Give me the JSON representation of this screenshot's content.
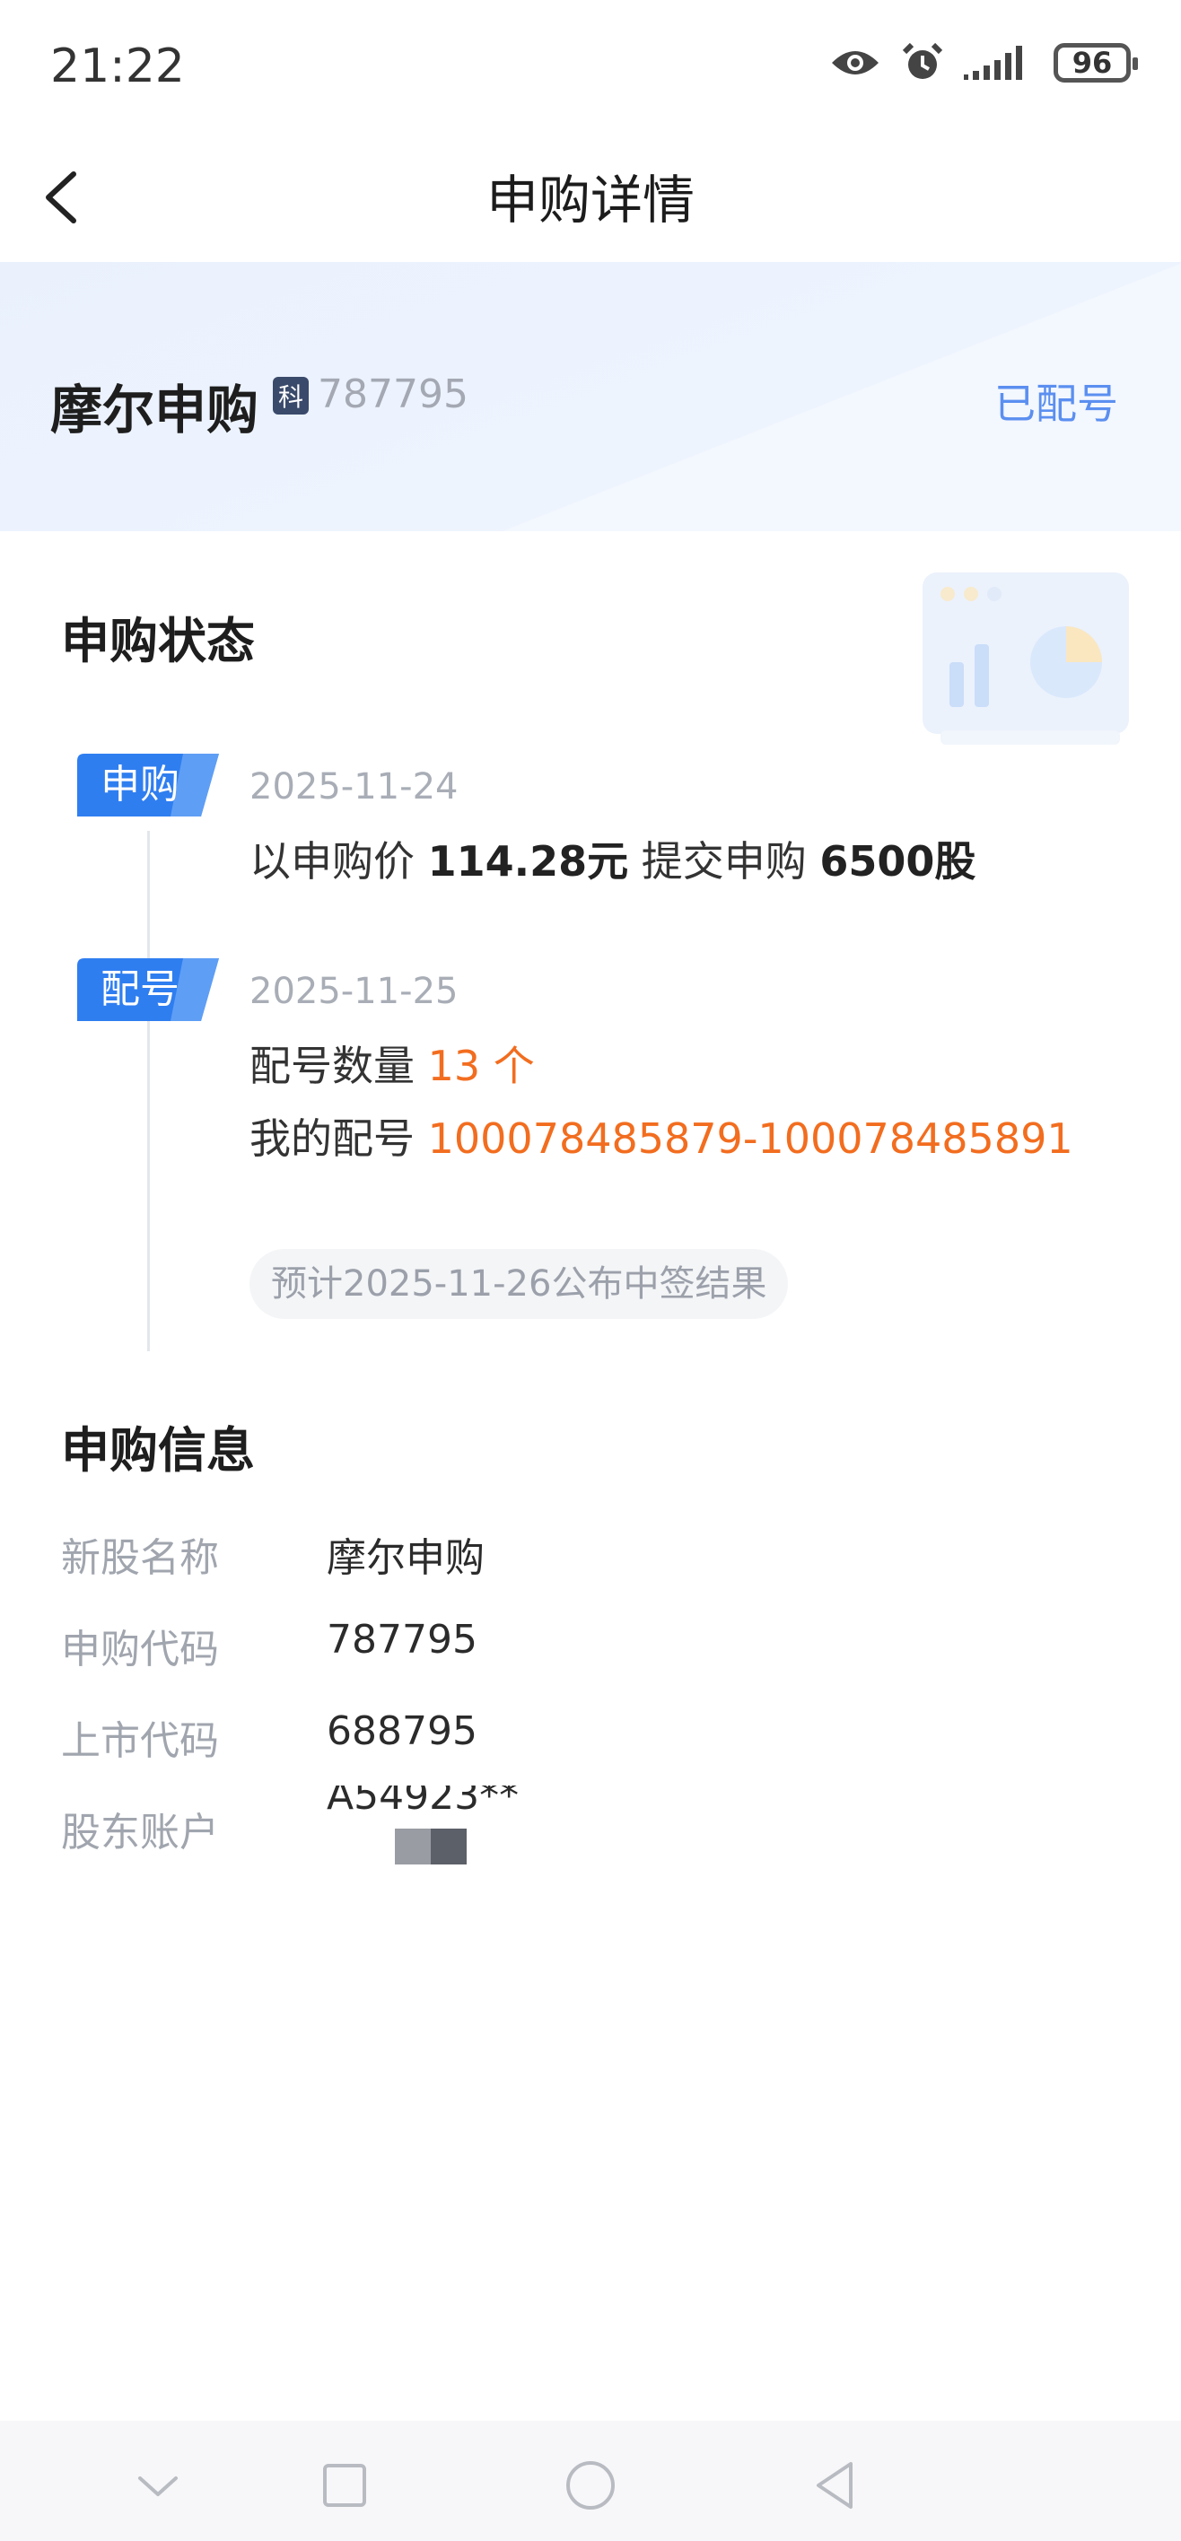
{
  "status_bar": {
    "time": "21:22",
    "battery": "96"
  },
  "nav": {
    "title": "申购详情"
  },
  "banner": {
    "name": "摩尔申购",
    "board_badge": "科",
    "code": "787795",
    "status": "已配号"
  },
  "status_section": {
    "title": "申购状态",
    "steps": [
      {
        "tag": "申购",
        "date": "2025-11-24",
        "prefix": "以申购价",
        "price": "114.28元",
        "mid": "提交申购",
        "shares": "6500股"
      },
      {
        "tag": "配号",
        "date": "2025-11-25",
        "count_label": "配号数量",
        "count_value": "13 个",
        "numbers_label": "我的配号",
        "numbers_value": "100078485879-100078485891",
        "tip": "预计2025-11-26公布中签结果"
      }
    ]
  },
  "info_section": {
    "title": "申购信息",
    "rows": [
      {
        "label": "新股名称",
        "value": "摩尔申购"
      },
      {
        "label": "申购代码",
        "value": "787795"
      },
      {
        "label": "上市代码",
        "value": "688795"
      },
      {
        "label": "股东账户",
        "value": "A54923**"
      }
    ]
  },
  "colors": {
    "accent": "#f26d1f",
    "link": "#5b8ff0",
    "tag": "#2f7ef0"
  },
  "icons": [
    "back-arrow-icon",
    "eye-icon",
    "alarm-icon",
    "signal-icon",
    "battery-icon",
    "chart-illustration-icon",
    "nav-back-icon",
    "nav-home-icon",
    "nav-recents-icon",
    "nav-collapse-icon"
  ]
}
